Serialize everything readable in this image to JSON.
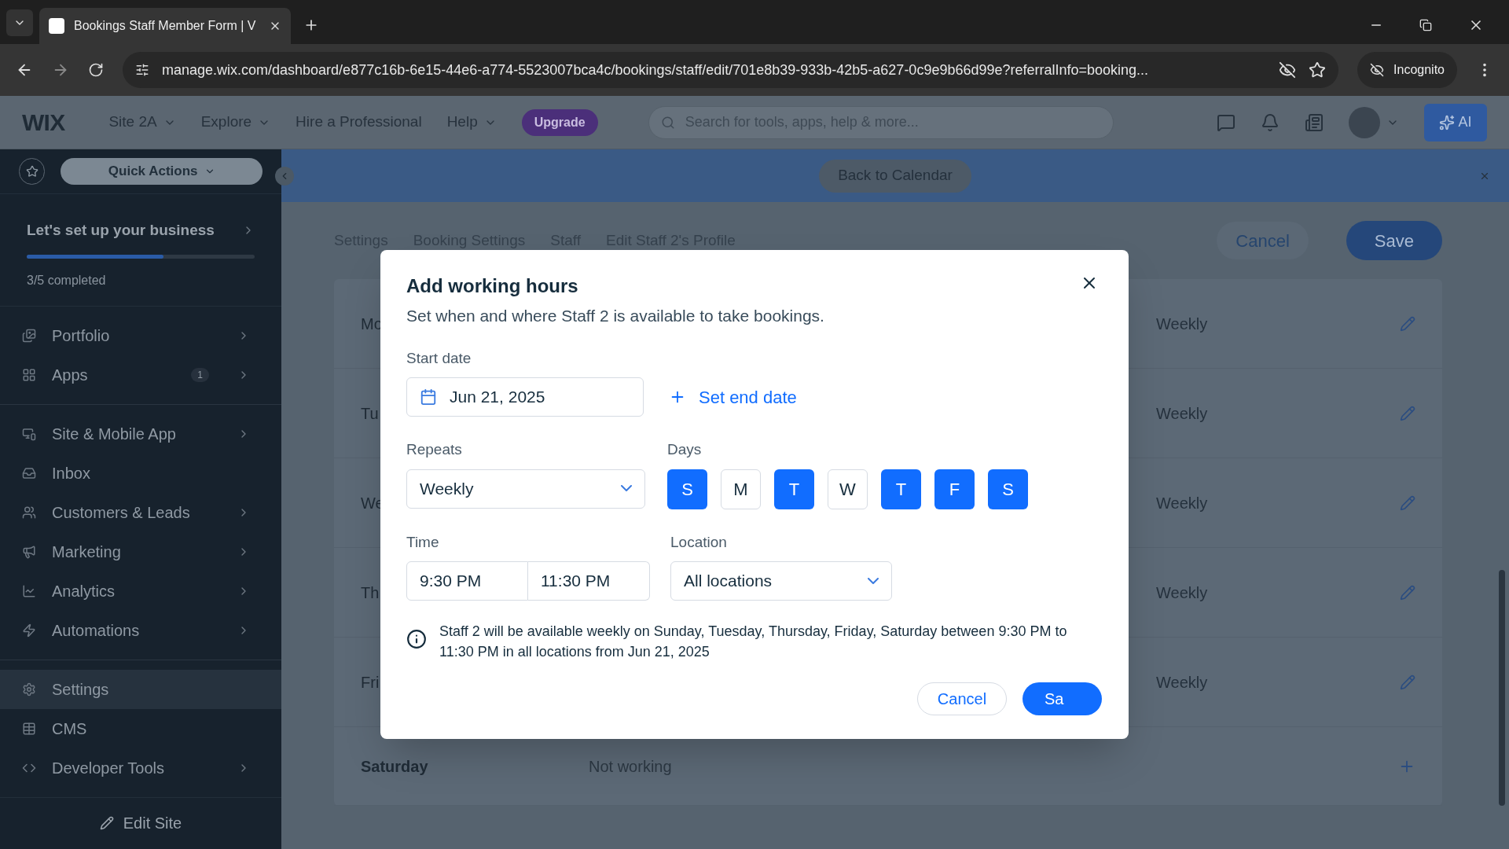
{
  "browser": {
    "tab_title": "Bookings Staff Member Form | V",
    "url": "manage.wix.com/dashboard/e877c16b-6e15-44e6-a774-5523007bca4c/bookings/staff/edit/701e8b39-933b-42b5-a627-0c9e9b66d99e?referralInfo=booking...",
    "profile": "Incognito"
  },
  "topbar": {
    "logo": "WIX",
    "site": "Site 2A",
    "nav": [
      {
        "label": "Explore",
        "dropdown": true
      },
      {
        "label": "Hire a Professional",
        "dropdown": false
      },
      {
        "label": "Help",
        "dropdown": true
      }
    ],
    "upgrade": "Upgrade",
    "search": {
      "placeholder": "Search for tools, apps, help & more..."
    },
    "ai": "AI"
  },
  "sidebar": {
    "quick_actions": "Quick Actions",
    "setup": {
      "title": "Let's set up your business",
      "level": 0.6,
      "progress": "3/5 completed"
    },
    "groups": [
      [
        {
          "label": "Portfolio",
          "has_submenu": true,
          "selected": false
        },
        {
          "label": "Apps",
          "badge": "1",
          "has_submenu": true,
          "selected": false
        }
      ],
      [
        {
          "label": "Site & Mobile App",
          "has_submenu": true,
          "selected": false
        },
        {
          "label": "Inbox",
          "has_submenu": false,
          "selected": false
        },
        {
          "label": "Customers & Leads",
          "has_submenu": true,
          "selected": false
        },
        {
          "label": "Marketing",
          "has_submenu": true,
          "selected": false
        },
        {
          "label": "Analytics",
          "has_submenu": true,
          "selected": false
        },
        {
          "label": "Automations",
          "has_submenu": true,
          "selected": false
        }
      ],
      [
        {
          "label": "Settings",
          "has_submenu": false,
          "selected": true
        },
        {
          "label": "CMS",
          "has_submenu": false,
          "selected": false
        },
        {
          "label": "Developer Tools",
          "has_submenu": true,
          "selected": false
        }
      ]
    ],
    "edit_site": "Edit Site"
  },
  "banner": {
    "button": "Back to Calendar"
  },
  "page": {
    "breadcrumbs": [
      "Settings",
      "Booking Settings",
      "Staff",
      "Edit Staff 2's Profile"
    ],
    "cancel": "Cancel",
    "save": "Save",
    "rows": [
      {
        "day": "Mo",
        "repeat": "Weekly",
        "working": true
      },
      {
        "day": "Tu",
        "repeat": "Weekly",
        "working": true
      },
      {
        "day": "We",
        "repeat": "Weekly",
        "working": true
      },
      {
        "day": "Th",
        "repeat": "Weekly",
        "working": true
      },
      {
        "day": "Fri",
        "repeat": "Weekly",
        "working": true
      },
      {
        "day": "Saturday",
        "status": "Not working",
        "working": false
      }
    ]
  },
  "dialog": {
    "title": "Add working hours",
    "subtitle": "Set when and where Staff 2 is available to take bookings.",
    "start_label": "Start date",
    "start_date": "Jun 21, 2025",
    "end_link": "Set end date",
    "repeats_label": "Repeats",
    "repeats": "Weekly",
    "days_label": "Days",
    "days": [
      {
        "label": "S",
        "selected": true
      },
      {
        "label": "M",
        "selected": false
      },
      {
        "label": "T",
        "selected": true
      },
      {
        "label": "W",
        "selected": false
      },
      {
        "label": "T",
        "selected": true
      },
      {
        "label": "F",
        "selected": true
      },
      {
        "label": "S",
        "selected": true
      }
    ],
    "time_label": "Time",
    "time_from": "9:30 PM",
    "time_to": "11:30 PM",
    "location_label": "Location",
    "location": "All locations",
    "info": "Staff 2 will be available weekly on Sunday, Tuesday, Thursday, Friday, Saturday between 9:30 PM to 11:30 PM in all locations from Jun 21, 2025",
    "cancel": "Cancel",
    "save": "Sa"
  }
}
